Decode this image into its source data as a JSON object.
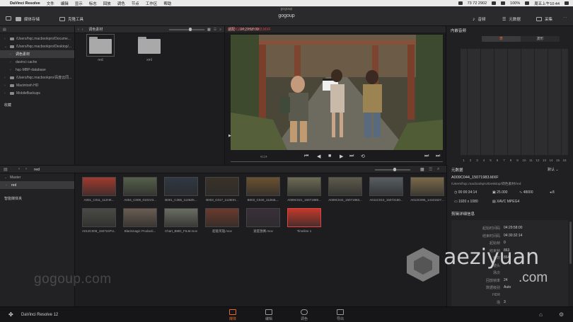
{
  "menubar": {
    "app": "DaVinci Resolve",
    "items": [
      "文件",
      "编辑",
      "显示",
      "标志",
      "回放",
      "调色",
      "节点",
      "工作区",
      "帮助"
    ],
    "status": {
      "network": "73 72 2902",
      "battery": "100%",
      "datetime": "周五上午10:44"
    }
  },
  "titlebar": {
    "window_title": "gogoup",
    "project": "gogoup",
    "left_buttons": [
      "媒体存储",
      "克隆工具"
    ],
    "right_buttons": [
      "音频",
      "元数据",
      "采集"
    ]
  },
  "media_storage": {
    "tree": [
      {
        "label": "/Users/hqc.macbookpro/Docume...",
        "type": "drive",
        "expanded": false
      },
      {
        "label": "/Users/hqc.macbookpro/Desktop/...",
        "type": "drive",
        "expanded": true
      },
      {
        "label": "调色素材",
        "type": "folder",
        "selected": true
      },
      {
        "label": "davinci cache",
        "type": "folder"
      },
      {
        "label": "hqc-MBP-database",
        "type": "folder"
      },
      {
        "label": "/Users/hqc.macbookpro/百度云同...",
        "type": "drive"
      },
      {
        "label": "Macintosh HD",
        "type": "drive"
      },
      {
        "label": "MobileBackups",
        "type": "drive"
      }
    ],
    "favorites_label": "收藏",
    "path_label": "调色素材",
    "folders": [
      {
        "name": "red",
        "selected": true
      },
      {
        "name": "xml",
        "selected": false
      }
    ]
  },
  "viewer": {
    "mode": "适配",
    "clip_name": "A009C044_15071983.MXF",
    "timecode": "04:29:58:00"
  },
  "audio": {
    "title": "内嵌音频",
    "tabs": [
      "表",
      "波形"
    ],
    "channels": [
      "1",
      "2",
      "3",
      "4",
      "5",
      "6",
      "7",
      "8",
      "9",
      "10",
      "11",
      "12",
      "13",
      "14",
      "15",
      "16"
    ]
  },
  "bin": {
    "path": "red",
    "tree": [
      {
        "label": "Master",
        "expanded": true
      },
      {
        "label": "red",
        "selected": true
      }
    ],
    "smart_bins": "智能媒体夹",
    "clips": [
      {
        "name": "A001_C011_112HK...",
        "color": "#a03a2e"
      },
      {
        "name": "A004_C009_0101V3...",
        "color": "#55604b"
      },
      {
        "name": "B001_C355_1126ZK...",
        "color": "#2f3844"
      },
      {
        "name": "B003_C017_11260H...",
        "color": "#3a3228"
      },
      {
        "name": "B003_C040_11263L...",
        "color": "#6a5130"
      },
      {
        "name": "A009C021_15071989...",
        "color": "#6d6a55"
      },
      {
        "name": "A009C044_15071983...",
        "color": "#5e5a4c"
      },
      {
        "name": "A011C010_15072180...",
        "color": "#585e62"
      },
      {
        "name": "A013C006_14101527...",
        "color": "#7a6a4a"
      },
      {
        "name": "A013C008_150724PU...",
        "color": "#4a4a45"
      },
      {
        "name": "Blackmagic Producti...",
        "color": "#6a5d52"
      },
      {
        "name": "Chart_BMD_FILM.mov",
        "color": "#6a6d62"
      },
      {
        "name": "超能英雄.mov",
        "color": "#6b3a2c"
      },
      {
        "name": "速度激赛.mov",
        "color": "#3a2f3a"
      },
      {
        "name": "Timeline 1",
        "color": "#c0392b",
        "timeline": true
      }
    ]
  },
  "metadata": {
    "title": "元数据",
    "sort": "默认",
    "clip_name": "A009C044_15071983.MXF",
    "clip_path": "/Users/hqc.macbookpro/Desktop/调色素材/red",
    "duration": "00:00:34:14",
    "fps": "25.000",
    "sample_rate": "48000",
    "audio_channels": "8",
    "resolution": "1920 x 1080",
    "codec": "XAVC MPEG4",
    "section": "剪辑详细信息",
    "details": [
      {
        "k": "起始时间码",
        "v": "04:29:58:00"
      },
      {
        "k": "结束时间码",
        "v": "04:30:32:14"
      },
      {
        "k": "起始帧",
        "v": "0"
      },
      {
        "k": "结束帧",
        "v": "863"
      },
      {
        "k": "帧数",
        "v": "864"
      },
      {
        "k": "镜头",
        "v": ""
      },
      {
        "k": "场次",
        "v": ""
      },
      {
        "k": "回放帧率",
        "v": "24"
      },
      {
        "k": "数据级别",
        "v": "Auto"
      },
      {
        "k": "HDR",
        "v": ""
      },
      {
        "k": "场",
        "v": "3"
      }
    ]
  },
  "bottomnav": {
    "app_name": "DaVinci Resolve 12",
    "tabs": [
      "媒体",
      "编辑",
      "调色",
      "导出"
    ],
    "active": "媒体"
  },
  "watermarks": {
    "left": "gogoup.com",
    "right_top": "aeziyuan",
    "right_bottom": ".com"
  },
  "colors": {
    "accent": "#e36a2d",
    "clip_red": "#d44040"
  }
}
